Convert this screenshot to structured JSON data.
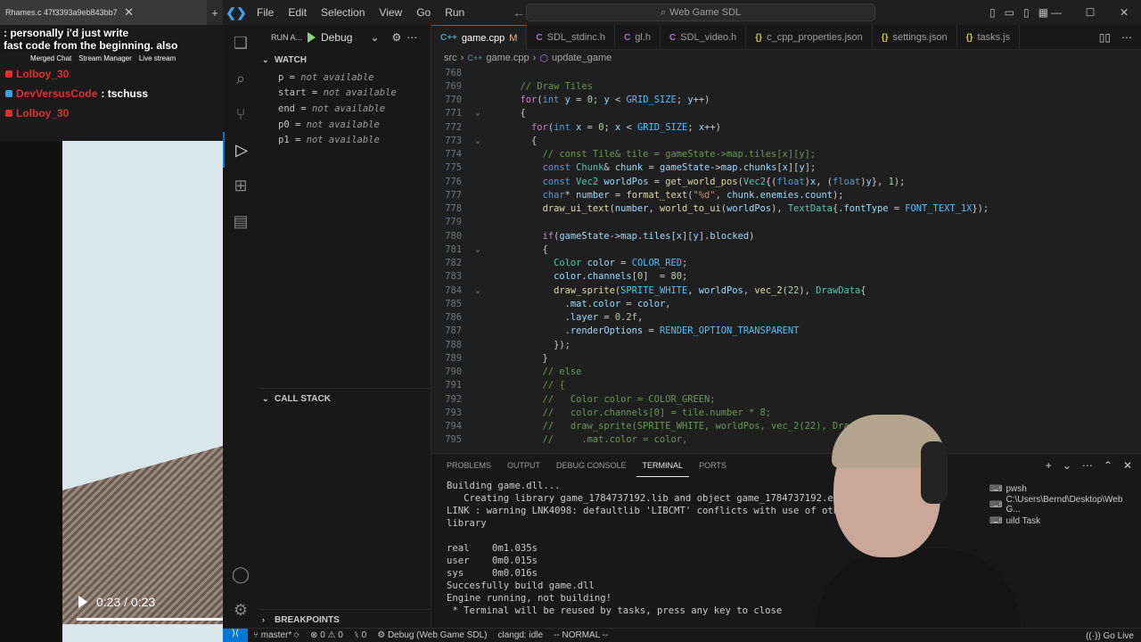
{
  "browser": {
    "tab_title": "Rhames.c 47f3393a9eb843bb7",
    "new_tab": "+",
    "close_tab": "✕"
  },
  "chat": {
    "highlight_msg": ": personally i'd just write",
    "highlight_msg2": "fast code from the beginning. also",
    "toolbar": [
      "Merged Chat",
      "Stream Manager",
      "Live stream"
    ],
    "messages": [
      {
        "user": "Lolboy_30",
        "text": "",
        "color": "#e03030"
      },
      {
        "user": "DevVersusCode",
        "text": ": tschuss",
        "color": "#e03030"
      },
      {
        "user": "Lolboy_30",
        "text": "",
        "color": "#e03030"
      }
    ]
  },
  "video": {
    "time": "0:23 / 0:23"
  },
  "titlebar": {
    "menu": [
      "File",
      "Edit",
      "Selection",
      "View",
      "Go",
      "Run"
    ],
    "search": "Web Game SDL"
  },
  "sidebar": {
    "run_label": "RUN A...",
    "config": "Debug",
    "watch_title": "WATCH",
    "watch": [
      {
        "name": "p",
        "value": "not available"
      },
      {
        "name": "start",
        "value": "not available"
      },
      {
        "name": "end",
        "value": "not available"
      },
      {
        "name": "p0",
        "value": "not available"
      },
      {
        "name": "p1",
        "value": "not available"
      }
    ],
    "callstack_title": "CALL STACK",
    "breakpoints_title": "BREAKPOINTS"
  },
  "tabs": [
    {
      "icon": "C++",
      "label": "game.cpp",
      "badge": "M",
      "active": true,
      "color": "#519aba"
    },
    {
      "icon": "C",
      "label": "SDL_stdinc.h",
      "badge": "",
      "active": false,
      "color": "#a074c4"
    },
    {
      "icon": "C",
      "label": "gl.h",
      "badge": "",
      "active": false,
      "color": "#a074c4"
    },
    {
      "icon": "C",
      "label": "SDL_video.h",
      "badge": "",
      "active": false,
      "color": "#a074c4"
    },
    {
      "icon": "{}",
      "label": "c_cpp_properties.json",
      "badge": "",
      "active": false,
      "color": "#cbcb41"
    },
    {
      "icon": "{}",
      "label": "settings.json",
      "badge": "",
      "active": false,
      "color": "#cbcb41"
    },
    {
      "icon": "{}",
      "label": "tasks.js",
      "badge": "",
      "active": false,
      "color": "#cbcb41"
    }
  ],
  "breadcrumb": {
    "folder": "src",
    "file": "game.cpp",
    "symbol": "update_game"
  },
  "code_lines": [
    {
      "n": "768",
      "fold": "",
      "html": ""
    },
    {
      "n": "769",
      "fold": "",
      "html": "      <span class='cm'>// Draw Tiles</span>"
    },
    {
      "n": "770",
      "fold": "",
      "html": "      <span class='ctl'>for</span>(<span class='kw'>int</span> <span class='var'>y</span> = <span class='num'>0</span>; <span class='var'>y</span> &lt; <span class='const'>GRID_SIZE</span>; <span class='var'>y</span>++)"
    },
    {
      "n": "771",
      "fold": "⌄",
      "html": "      {"
    },
    {
      "n": "772",
      "fold": "",
      "html": "        <span class='ctl'>for</span>(<span class='kw'>int</span> <span class='var'>x</span> = <span class='num'>0</span>; <span class='var'>x</span> &lt; <span class='const'>GRID_SIZE</span>; <span class='var'>x</span>++)"
    },
    {
      "n": "773",
      "fold": "⌄",
      "html": "        {"
    },
    {
      "n": "774",
      "fold": "",
      "html": "          <span class='cm'>// const Tile&amp; tile = gameState-&gt;map.tiles[x][y];</span>"
    },
    {
      "n": "775",
      "fold": "",
      "html": "          <span class='kw'>const</span> <span class='ty'>Chunk</span>&amp; <span class='var'>chunk</span> = <span class='var'>gameState</span>-&gt;<span class='var'>map</span>.<span class='var'>chunks</span>[<span class='var'>x</span>][<span class='var'>y</span>];"
    },
    {
      "n": "776",
      "fold": "",
      "html": "          <span class='kw'>const</span> <span class='ty'>Vec2</span> <span class='var'>worldPos</span> = <span class='fn'>get_world_pos</span>(<span class='ty'>Vec2</span>{(<span class='kw'>float</span>)<span class='var'>x</span>, (<span class='kw'>float</span>)<span class='var'>y</span>}, <span class='num'>1</span>);"
    },
    {
      "n": "777",
      "fold": "",
      "html": "          <span class='kw'>char</span>* <span class='var'>number</span> = <span class='fn'>format_text</span>(<span class='str'>\"%d\"</span>, <span class='var'>chunk</span>.<span class='var'>enemies</span>.<span class='var'>count</span>);"
    },
    {
      "n": "778",
      "fold": "",
      "html": "          <span class='fn'>draw_ui_text</span>(<span class='var'>number</span>, <span class='fn'>world_to_ui</span>(<span class='var'>worldPos</span>), <span class='ty'>TextData</span>{.<span class='var'>fontType</span> = <span class='const'>FONT_TEXT_1X</span>});"
    },
    {
      "n": "779",
      "fold": "",
      "html": ""
    },
    {
      "n": "780",
      "fold": "",
      "html": "          <span class='ctl'>if</span>(<span class='var'>gameState</span>-&gt;<span class='var'>map</span>.<span class='var'>tiles</span>[<span class='var'>x</span>][<span class='var'>y</span>].<span class='var'>blocked</span>)"
    },
    {
      "n": "781",
      "fold": "⌄",
      "html": "          {"
    },
    {
      "n": "782",
      "fold": "",
      "html": "            <span class='ty'>Color</span> <span class='var'>color</span> = <span class='const'>COLOR_RED</span>;"
    },
    {
      "n": "783",
      "fold": "",
      "html": "            <span class='var'>color</span>.<span class='var'>channels</span>[<span class='num'>0</span>]  = <span class='num'>80</span>;"
    },
    {
      "n": "784",
      "fold": "⌄",
      "html": "            <span class='fn'>draw_sprite</span>(<span class='const'>SPRITE_WHITE</span>, <span class='var'>worldPos</span>, <span class='fn'>vec_2</span>(<span class='num'>22</span>), <span class='ty'>DrawData</span>{"
    },
    {
      "n": "785",
      "fold": "",
      "html": "              .<span class='var'>mat</span>.<span class='var'>color</span> = <span class='var'>color</span>,"
    },
    {
      "n": "786",
      "fold": "",
      "html": "              .<span class='var'>layer</span> = <span class='num'>0.2f</span>,"
    },
    {
      "n": "787",
      "fold": "",
      "html": "              .<span class='var'>renderOptions</span> = <span class='const'>RENDER_OPTION_TRANSPARENT</span>"
    },
    {
      "n": "788",
      "fold": "",
      "html": "            });"
    },
    {
      "n": "789",
      "fold": "",
      "html": "          }"
    },
    {
      "n": "790",
      "fold": "",
      "html": "          <span class='cm'>// else</span>"
    },
    {
      "n": "791",
      "fold": "",
      "html": "          <span class='cm'>// {</span>"
    },
    {
      "n": "792",
      "fold": "",
      "html": "          <span class='cm'>//   Color color = COLOR_GREEN;</span>"
    },
    {
      "n": "793",
      "fold": "",
      "html": "          <span class='cm'>//   color.channels[0] = tile.number * 8;</span>"
    },
    {
      "n": "794",
      "fold": "",
      "html": "          <span class='cm'>//   draw_sprite(SPRITE_WHITE, worldPos, vec_2(22), Dra</span>"
    },
    {
      "n": "795",
      "fold": "",
      "html": "          <span class='cm'>//     .mat.color = color,</span>"
    }
  ],
  "panel": {
    "tabs": [
      "PROBLEMS",
      "OUTPUT",
      "DEBUG CONSOLE",
      "TERMINAL",
      "PORTS"
    ],
    "active": "TERMINAL",
    "terminal": [
      "Building game.dll...",
      "   Creating library game_1784737192.lib and object game_1784737192.exp",
      "LINK : warning LNK4098: defaultlib 'LIBCMT' conflicts with use of other l",
      "library",
      "",
      "real    0m1.035s",
      "user    0m0.015s",
      "sys     0m0.016s",
      "Succesfully build game.dll",
      "Engine running, not building!",
      " * Terminal will be reused by tasks, press any key to close"
    ],
    "term_list": [
      {
        "label": "pwsh"
      },
      {
        "label": "C:\\Users\\Bernd\\Desktop\\Web G..."
      },
      {
        "label": "uild  Task"
      }
    ]
  },
  "statusbar": {
    "branch": "master*",
    "sync": "⟳",
    "errors": "0",
    "warnings": "0",
    "ports": "0",
    "debug": "Debug (Web Game SDL)",
    "clangd": "clangd: idle",
    "mode": "-- NORMAL --",
    "golive": "Go Live"
  }
}
